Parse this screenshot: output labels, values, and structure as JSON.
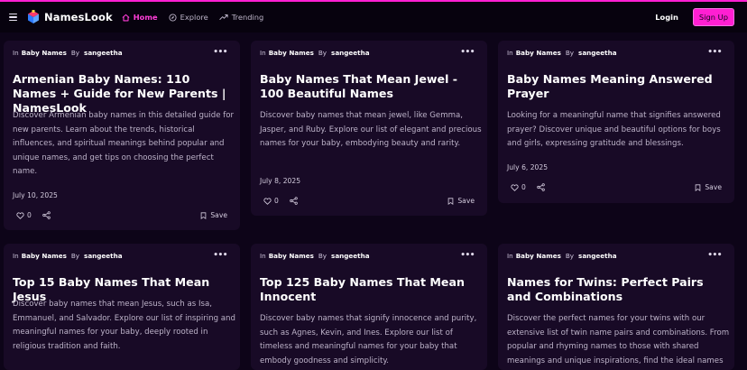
{
  "nav": {
    "brand": "NamesLook",
    "links": [
      {
        "label": "Home",
        "icon": "home-icon",
        "active": true
      },
      {
        "label": "Explore",
        "icon": "compass-icon",
        "active": false
      },
      {
        "label": "Trending",
        "icon": "trending-icon",
        "active": false
      }
    ],
    "login_label": "Login",
    "signup_label": "Sign Up"
  },
  "colors": {
    "accent": "#ff1fd2",
    "background": "#0d0418",
    "card": "#180a26"
  },
  "card_labels": {
    "in": "In",
    "by": "By",
    "save": "Save"
  },
  "cards": [
    {
      "category": "Baby Names",
      "author": "sangeetha",
      "title": "Armenian Baby Names: 110 Names + Guide for New Parents | NamesLook",
      "description": "Discover Armenian baby names in this detailed guide for new parents. Learn about the trends, historical influences, and spiritual meanings behind popular and unique names, and get tips on choosing the perfect name.",
      "date": "July 10, 2025",
      "likes": "0"
    },
    {
      "category": "Baby Names",
      "author": "sangeetha",
      "title": "Baby Names That Mean Jewel - 100 Beautiful Names",
      "description": "Discover baby names that mean jewel, like Gemma, Jasper, and Ruby. Explore our list of elegant and precious names for your baby, embodying beauty and rarity.",
      "date": "July 8, 2025",
      "likes": "0"
    },
    {
      "category": "Baby Names",
      "author": "sangeetha",
      "title": "Baby Names Meaning Answered Prayer",
      "description": "Looking for a meaningful name that signifies answered prayer? Discover unique and beautiful options for boys and girls, expressing gratitude and blessings.",
      "date": "July 6, 2025",
      "likes": "0"
    },
    {
      "category": "Baby Names",
      "author": "sangeetha",
      "title": "Top 15 Baby Names That Mean Jesus",
      "description": "Discover baby names that mean Jesus, such as Isa, Emmanuel, and Salvador. Explore our list of inspiring and meaningful names for your baby, deeply rooted in religious tradition and faith."
    },
    {
      "category": "Baby Names",
      "author": "sangeetha",
      "title": "Top 125 Baby Names That Mean Innocent",
      "description": "Discover baby names that signify innocence and purity, such as Agnes, Kevin, and Ines. Explore our list of timeless and meaningful names for your baby that embody goodness and simplicity."
    },
    {
      "category": "Baby Names",
      "author": "sangeetha",
      "title": "Names for Twins: Perfect Pairs and Combinations",
      "description": "Discover the perfect names for your twins with our extensive list of twin name pairs and combinations. From popular and rhyming names to those with shared meanings and unique inspirations, find the ideal names"
    }
  ]
}
